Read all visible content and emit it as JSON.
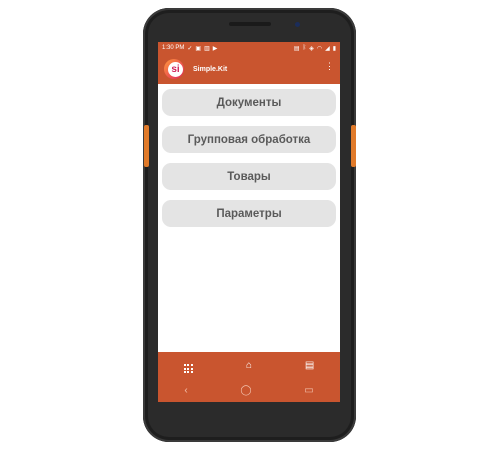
{
  "status_bar": {
    "time": "1:30 PM"
  },
  "app": {
    "title": "Simple.Kit",
    "logo_text": "si"
  },
  "menu": {
    "items": [
      {
        "label": "Документы"
      },
      {
        "label": "Групповая обработка"
      },
      {
        "label": "Товары"
      },
      {
        "label": "Параметры"
      }
    ]
  },
  "bottom_tabs": [
    {
      "icon": "apps-grid-icon"
    },
    {
      "icon": "home-icon"
    },
    {
      "icon": "message-icon"
    }
  ],
  "system_nav": {
    "back_glyph": "‹",
    "home_glyph": "◯",
    "recents_glyph": "▭"
  },
  "colors": {
    "accent": "#c9552f",
    "button_bg": "#e4e4e4",
    "button_text": "#5a5a5a",
    "device_body": "#2b2b2b",
    "side_key": "#e07a2a"
  }
}
